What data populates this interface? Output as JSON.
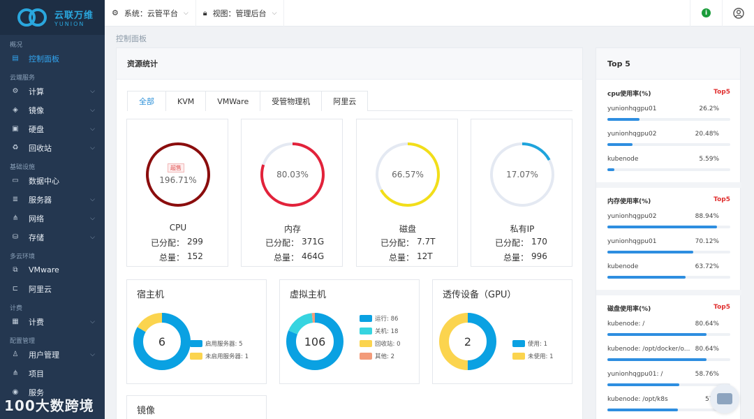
{
  "logo": {
    "title": "云联万维",
    "subtitle": "YUNION"
  },
  "sidebar": {
    "sections": [
      {
        "title": "概况",
        "items": [
          {
            "label": "控制面板",
            "icon": "dashboard-icon",
            "active": true
          }
        ]
      },
      {
        "title": "云端服务",
        "items": [
          {
            "label": "计算",
            "icon": "compute-icon",
            "expandable": true
          },
          {
            "label": "镜像",
            "icon": "image-icon",
            "expandable": true
          },
          {
            "label": "硬盘",
            "icon": "disk-icon",
            "expandable": true
          },
          {
            "label": "回收站",
            "icon": "recycle-icon",
            "expandable": true
          }
        ]
      },
      {
        "title": "基础设施",
        "items": [
          {
            "label": "数据中心",
            "icon": "datacenter-icon",
            "expandable": false
          },
          {
            "label": "服务器",
            "icon": "server-icon",
            "expandable": true
          },
          {
            "label": "网络",
            "icon": "network-icon",
            "expandable": true
          },
          {
            "label": "存储",
            "icon": "storage-icon",
            "expandable": true
          }
        ]
      },
      {
        "title": "多云环境",
        "items": [
          {
            "label": "VMware",
            "icon": "vmware-icon",
            "expandable": false
          },
          {
            "label": "阿里云",
            "icon": "aliyun-icon",
            "expandable": false
          }
        ]
      },
      {
        "title": "计费",
        "items": [
          {
            "label": "计费",
            "icon": "billing-icon",
            "expandable": true
          }
        ]
      },
      {
        "title": "配置管理",
        "items": [
          {
            "label": "用户管理",
            "icon": "user-manage-icon",
            "expandable": true
          },
          {
            "label": "项目",
            "icon": "project-icon",
            "expandable": false
          },
          {
            "label": "服务",
            "icon": "service-icon",
            "expandable": false
          }
        ]
      }
    ]
  },
  "topbar": {
    "system_label": "系统：云管平台",
    "view_label": "视图：管理后台"
  },
  "breadcrumb": "控制面板",
  "resource": {
    "title": "资源统计",
    "tabs": [
      "全部",
      "KVM",
      "VMWare",
      "受管物理机",
      "阿里云"
    ],
    "gauges": [
      {
        "name": "CPU",
        "value_text": "196.71%",
        "percent": 196.71,
        "badge": "超售",
        "allocated_label": "已分配：",
        "allocated": "299",
        "total_label": "总量：",
        "total": "152",
        "color": "#8b0d0d"
      },
      {
        "name": "内存",
        "value_text": "80.03%",
        "percent": 80.03,
        "allocated_label": "已分配：",
        "allocated": "371G",
        "total_label": "总量：",
        "total": "464G",
        "color": "#e2223a"
      },
      {
        "name": "磁盘",
        "value_text": "66.57%",
        "percent": 66.57,
        "allocated_label": "已分配：",
        "allocated": "7.7T",
        "total_label": "总量：",
        "total": "12T",
        "color": "#f2de19"
      },
      {
        "name": "私有IP",
        "value_text": "17.07%",
        "percent": 17.07,
        "allocated_label": "已分配：",
        "allocated": "170",
        "total_label": "总量：",
        "total": "996",
        "color": "#1ea4dc"
      }
    ],
    "host": {
      "title": "宿主机",
      "center": "6",
      "segments": [
        {
          "label": "启用服务器: 5",
          "value": 5,
          "color": "#0aa1e2"
        },
        {
          "label": "未启用服务器: 1",
          "value": 1,
          "color": "#fbd44e"
        }
      ]
    },
    "vm": {
      "title": "虚拟主机",
      "center": "106",
      "segments": [
        {
          "label": "运行: 86",
          "value": 86,
          "color": "#0aa1e2"
        },
        {
          "label": "关机: 18",
          "value": 18,
          "color": "#36d4e0"
        },
        {
          "label": "回收站: 0",
          "value": 0,
          "color": "#fbd44e"
        },
        {
          "label": "其他: 2",
          "value": 2,
          "color": "#f39b7a"
        }
      ]
    },
    "gpu": {
      "title": "透传设备（GPU）",
      "center": "2",
      "segments": [
        {
          "label": "使用: 1",
          "value": 1,
          "color": "#0aa1e2"
        },
        {
          "label": "未使用: 1",
          "value": 1,
          "color": "#fbd44e"
        }
      ]
    },
    "mirror": {
      "title": "镜像"
    }
  },
  "top5": {
    "title": "Top 5",
    "sections": [
      {
        "title": "cpu使用率(%)",
        "badge": "Top5",
        "items": [
          {
            "name": "yunionhqgpu01",
            "value_text": "26.2%",
            "percent": 26.2
          },
          {
            "name": "yunionhqgpu02",
            "value_text": "20.48%",
            "percent": 20.48
          },
          {
            "name": "kubenode",
            "value_text": "5.59%",
            "percent": 5.59
          }
        ]
      },
      {
        "title": "内存使用率(%)",
        "badge": "Top5",
        "items": [
          {
            "name": "yunionhqgpu02",
            "value_text": "88.94%",
            "percent": 88.94
          },
          {
            "name": "yunionhqgpu01",
            "value_text": "70.12%",
            "percent": 70.12
          },
          {
            "name": "kubenode",
            "value_text": "63.72%",
            "percent": 63.72
          }
        ]
      },
      {
        "title": "磁盘使用率(%)",
        "badge": "Top5",
        "items": [
          {
            "name": "kubenode: /",
            "value_text": "80.64%",
            "percent": 80.64
          },
          {
            "name": "kubenode: /opt/docker/o...",
            "value_text": "80.64%",
            "percent": 80.64
          },
          {
            "name": "yunionhqgpu01: /",
            "value_text": "58.76%",
            "percent": 58.76
          },
          {
            "name": "kubenode: /opt/k8s",
            "value_text": "57.4",
            "percent": 57.4
          }
        ]
      }
    ]
  },
  "watermark": "100大数跨境"
}
